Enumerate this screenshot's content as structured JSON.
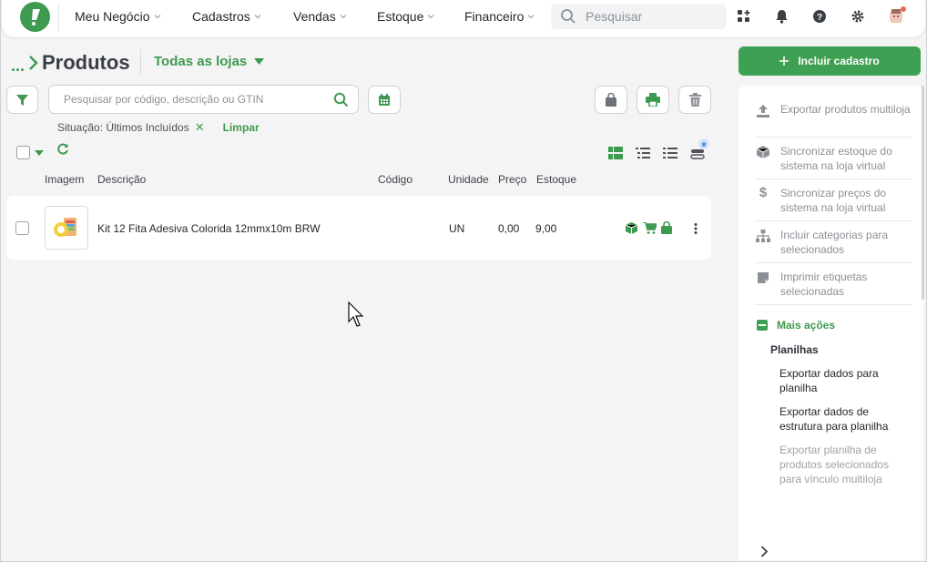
{
  "nav": {
    "items": [
      "Meu Negócio",
      "Cadastros",
      "Vendas",
      "Estoque",
      "Financeiro"
    ],
    "search_placeholder": "Pesquisar"
  },
  "header": {
    "breadcrumb_dots": "...",
    "title": "Produtos",
    "store_selector": "Todas as lojas",
    "include_button": "Incluir cadastro"
  },
  "filters": {
    "search_placeholder": "Pesquisar por código, descrição ou GTIN",
    "situation_label": "Situação: Últimos Incluídos",
    "clear_label": "Limpar"
  },
  "table": {
    "columns": [
      "Imagem",
      "Descrição",
      "Código",
      "Unidade",
      "Preço",
      "Estoque"
    ],
    "rows": [
      {
        "description": "Kit 12 Fita Adesiva Colorida 12mmx10m BRW",
        "code": "",
        "unit": "UN",
        "price": "0,00",
        "stock": "9,00"
      }
    ]
  },
  "panel": {
    "actions": [
      {
        "label": "Exportar produtos multiloja",
        "icon": "upload-icon"
      },
      {
        "label": "Sincronizar estoque do sistema na loja virtual",
        "icon": "box-icon"
      },
      {
        "label": "Sincronizar preços do sistema na loja virtual",
        "icon": "dollar-icon"
      },
      {
        "label": "Incluir categorias para selecionados",
        "icon": "hierarchy-icon"
      },
      {
        "label": "Imprimir etiquetas selecionadas",
        "icon": "tag-icon"
      }
    ],
    "more_actions": "Mais ações",
    "spreadsheets_heading": "Planilhas",
    "spreadsheet_items": [
      "Exportar dados para planilha",
      "Exportar dados de estrutura para planilha",
      "Exportar planilha de produtos selecionados para vínculo multiloja"
    ]
  },
  "colors": {
    "brand": "#3e9a4f",
    "accent_button": "#3ea052"
  }
}
